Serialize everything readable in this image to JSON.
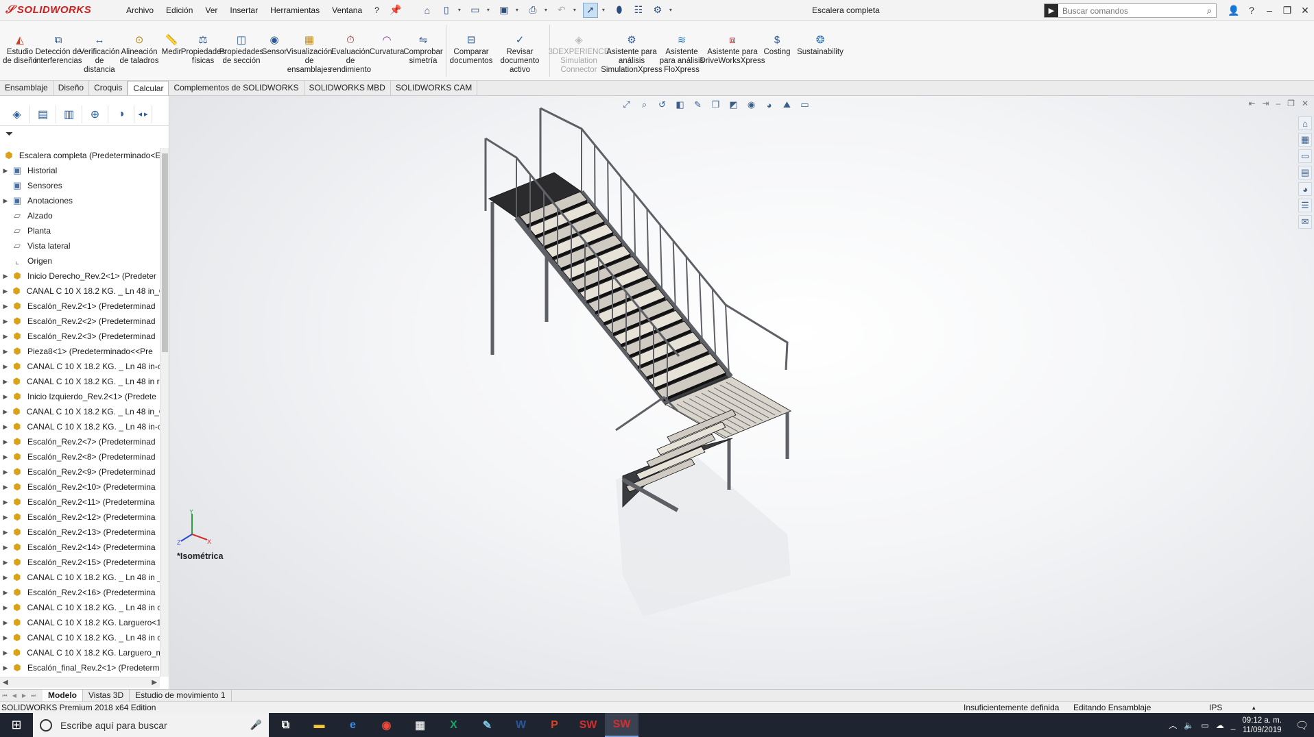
{
  "app": {
    "logo": "SOLIDWORKS",
    "doc_title": "Escalera completa",
    "menus": [
      "Archivo",
      "Edición",
      "Ver",
      "Insertar",
      "Herramientas",
      "Ventana",
      "?"
    ],
    "search_placeholder": "Buscar comandos"
  },
  "ribbon": {
    "buttons": [
      {
        "label": "Estudio de diseño",
        "icon": "design-study-icon",
        "disabled": false
      },
      {
        "label": "Detección de interferencias",
        "icon": "interference-icon",
        "disabled": false
      },
      {
        "label": "Verificación de distancia",
        "icon": "clearance-icon",
        "disabled": false
      },
      {
        "label": "Alineación de taladros",
        "icon": "hole-align-icon",
        "disabled": false
      },
      {
        "label": "Medir",
        "icon": "measure-icon",
        "disabled": false
      },
      {
        "label": "Propiedades físicas",
        "icon": "mass-props-icon",
        "disabled": false
      },
      {
        "label": "Propiedades de sección",
        "icon": "section-props-icon",
        "disabled": false
      },
      {
        "label": "Sensor",
        "icon": "sensor-icon",
        "disabled": false
      },
      {
        "label": "Visualización de ensamblajes",
        "icon": "assembly-vis-icon",
        "disabled": false
      },
      {
        "label": "Evaluación de rendimiento",
        "icon": "performance-icon",
        "disabled": false
      },
      {
        "label": "Curvatura",
        "icon": "curvature-icon",
        "disabled": false
      },
      {
        "label": "Comprobar simetría",
        "icon": "symmetry-icon",
        "disabled": false
      },
      {
        "label": "Comparar documentos",
        "icon": "compare-icon",
        "disabled": false
      },
      {
        "label": "Revisar documento activo",
        "icon": "check-doc-icon",
        "disabled": false
      },
      {
        "label": "3DEXPERIENCE Simulation Connector",
        "icon": "3dx-icon",
        "disabled": true
      },
      {
        "label": "Asistente para análisis SimulationXpress",
        "icon": "simxpress-icon",
        "disabled": false
      },
      {
        "label": "Asistente para análisis FloXpress",
        "icon": "floxpress-icon",
        "disabled": false
      },
      {
        "label": "Asistente para DriveWorksXpress",
        "icon": "driveworks-icon",
        "disabled": false
      },
      {
        "label": "Costing",
        "icon": "costing-icon",
        "disabled": false
      },
      {
        "label": "Sustainability",
        "icon": "sustainability-icon",
        "disabled": false
      }
    ]
  },
  "command_tabs": [
    "Ensamblaje",
    "Diseño",
    "Croquis",
    "Calcular",
    "Complementos de SOLIDWORKS",
    "SOLIDWORKS MBD",
    "SOLIDWORKS CAM"
  ],
  "active_command_tab": "Calcular",
  "tree": {
    "root": "Escalera completa  (Predeterminado<E",
    "items": [
      {
        "label": "Historial",
        "kind": "folder",
        "expandable": true
      },
      {
        "label": "Sensores",
        "kind": "folder",
        "expandable": false
      },
      {
        "label": "Anotaciones",
        "kind": "folder",
        "expandable": true
      },
      {
        "label": "Alzado",
        "kind": "plane",
        "expandable": false
      },
      {
        "label": "Planta",
        "kind": "plane",
        "expandable": false
      },
      {
        "label": "Vista lateral",
        "kind": "plane",
        "expandable": false
      },
      {
        "label": "Origen",
        "kind": "origin",
        "expandable": false
      },
      {
        "label": "Inicio Derecho_Rev.2<1> (Predeter",
        "kind": "part",
        "expandable": true
      },
      {
        "label": "CANAL C 10 X 18.2 KG. _ Ln 48 in_C",
        "kind": "part",
        "expandable": true
      },
      {
        "label": "Escalón_Rev.2<1> (Predeterminad",
        "kind": "part",
        "expandable": true
      },
      {
        "label": "Escalón_Rev.2<2> (Predeterminad",
        "kind": "part",
        "expandable": true
      },
      {
        "label": "Escalón_Rev.2<3> (Predeterminad",
        "kind": "part",
        "expandable": true
      },
      {
        "label": "Pieza8<1> (Predeterminado<<Pre",
        "kind": "part",
        "expandable": true
      },
      {
        "label": "CANAL C 10 X 18.2 KG. _ Ln 48 in-c",
        "kind": "part",
        "expandable": true
      },
      {
        "label": "CANAL C 10 X 18.2 KG. _ Ln 48 in re",
        "kind": "part",
        "expandable": true
      },
      {
        "label": "Inicio Izquierdo_Rev.2<1> (Predete",
        "kind": "part",
        "expandable": true
      },
      {
        "label": "CANAL C 10 X 18.2 KG. _ Ln 48 in_C",
        "kind": "part",
        "expandable": true
      },
      {
        "label": "CANAL C 10 X 18.2 KG. _ Ln 48 in-c",
        "kind": "part",
        "expandable": true
      },
      {
        "label": "Escalón_Rev.2<7> (Predeterminad",
        "kind": "part",
        "expandable": true
      },
      {
        "label": "Escalón_Rev.2<8> (Predeterminad",
        "kind": "part",
        "expandable": true
      },
      {
        "label": "Escalón_Rev.2<9> (Predeterminad",
        "kind": "part",
        "expandable": true
      },
      {
        "label": "Escalón_Rev.2<10> (Predetermina",
        "kind": "part",
        "expandable": true
      },
      {
        "label": "Escalón_Rev.2<11> (Predetermina",
        "kind": "part",
        "expandable": true
      },
      {
        "label": "Escalón_Rev.2<12> (Predetermina",
        "kind": "part",
        "expandable": true
      },
      {
        "label": "Escalón_Rev.2<13> (Predetermina",
        "kind": "part",
        "expandable": true
      },
      {
        "label": "Escalón_Rev.2<14> (Predetermina",
        "kind": "part",
        "expandable": true
      },
      {
        "label": "Escalón_Rev.2<15> (Predetermina",
        "kind": "part",
        "expandable": true
      },
      {
        "label": "CANAL C 10 X 18.2 KG. _ Ln 48 in _",
        "kind": "part",
        "expandable": true
      },
      {
        "label": "Escalón_Rev.2<16> (Predetermina",
        "kind": "part",
        "expandable": true
      },
      {
        "label": "CANAL C 10 X 18.2 KG. _ Ln 48 in c",
        "kind": "part",
        "expandable": true
      },
      {
        "label": "CANAL C 10 X 18.2 KG. Larguero<1",
        "kind": "part",
        "expandable": true
      },
      {
        "label": "CANAL C 10 X 18.2 KG. _ Ln 48 in c",
        "kind": "part",
        "expandable": true
      },
      {
        "label": "CANAL C 10 X 18.2 KG. Larguero_m",
        "kind": "part",
        "expandable": true
      },
      {
        "label": "Escalón_final_Rev.2<1> (Predeterm",
        "kind": "part",
        "expandable": true
      }
    ]
  },
  "graphics": {
    "view_name": "*Isométrica",
    "triad": {
      "x": "X",
      "y": "Y",
      "z": "Z"
    }
  },
  "bottom_tabs": [
    "Modelo",
    "Vistas 3D",
    "Estudio de movimiento 1"
  ],
  "active_bottom_tab": "Modelo",
  "status": {
    "edition": "SOLIDWORKS Premium 2018 x64 Edition",
    "definition": "Insuficientemente definida",
    "mode": "Editando Ensamblaje",
    "units": "IPS"
  },
  "taskbar": {
    "search_placeholder": "Escribe aquí para buscar",
    "apps": [
      {
        "name": "task-view-icon",
        "glyph": "⧉"
      },
      {
        "name": "file-explorer-icon",
        "glyph": "▬"
      },
      {
        "name": "edge-icon",
        "glyph": "e"
      },
      {
        "name": "chrome-icon",
        "glyph": "◉"
      },
      {
        "name": "calculator-icon",
        "glyph": "▦"
      },
      {
        "name": "excel-icon",
        "glyph": "X"
      },
      {
        "name": "notes-icon",
        "glyph": "✎"
      },
      {
        "name": "word-icon",
        "glyph": "W"
      },
      {
        "name": "powerpoint-icon",
        "glyph": "P"
      },
      {
        "name": "solidworks-2018-icon",
        "glyph": "SW"
      },
      {
        "name": "solidworks-2018-active-icon",
        "glyph": "SW"
      }
    ],
    "time": "09:12 a. m.",
    "date": "11/09/2019"
  },
  "colors": {
    "accent": "#2b5797",
    "logo_red": "#d01c1c",
    "part_yellow": "#d9a21b",
    "steel": "#5e6066"
  }
}
